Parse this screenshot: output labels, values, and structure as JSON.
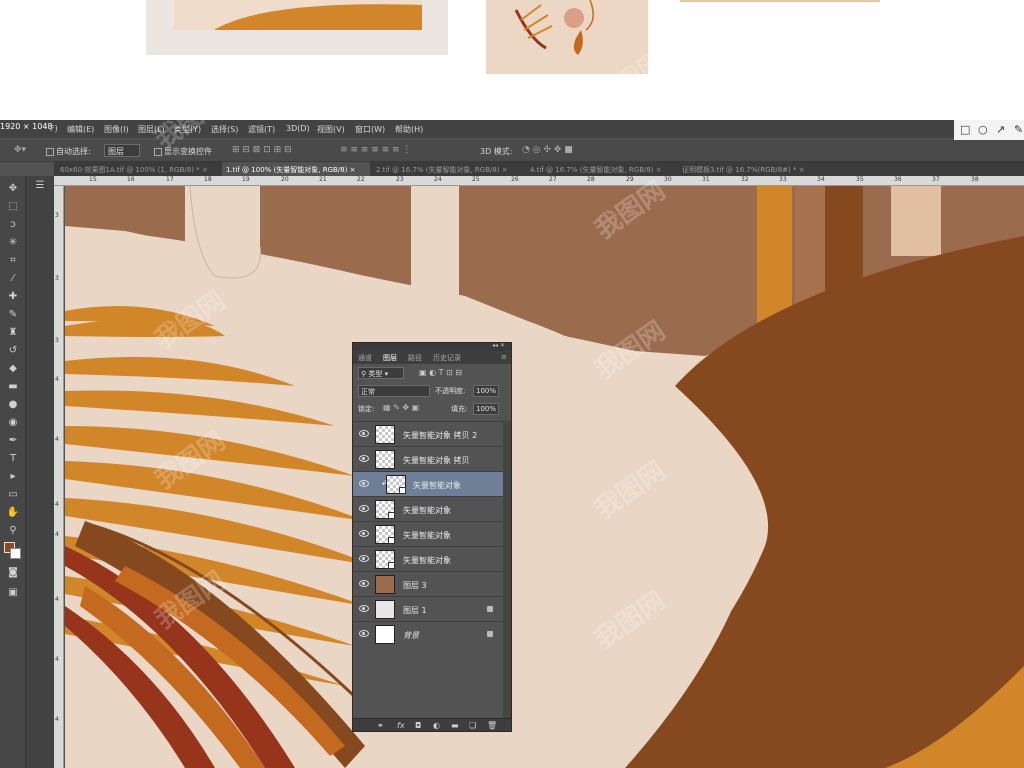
{
  "window": {
    "size_label": "1920 × 1048",
    "menu": [
      "编辑(E)",
      "图像(I)",
      "图层(L)",
      "类型(Y)",
      "选择(S)",
      "滤镜(T)",
      "3D(D)",
      "视图(V)",
      "窗口(W)",
      "帮助(H)"
    ],
    "menu_partial": "F)"
  },
  "options_bar": {
    "auto_select_label": "自动选择:",
    "auto_select_value": "图层",
    "show_transform_label": "显示变换控件",
    "mode_3d_label": "3D 模式:"
  },
  "tabs": [
    {
      "label": "60x60-效果图1A.tif @ 100% (1, RGB/8) *",
      "close": "×",
      "active": false
    },
    {
      "label": "1.tif @ 100% (矢量智能对象, RGB/8)",
      "close": "×",
      "active": true
    },
    {
      "label": "2.tif @ 16.7% (矢量智能对象, RGB/8)",
      "close": "×",
      "active": false
    },
    {
      "label": "4.tif @ 16.7% (矢量智能对象, RGB/8)",
      "close": "×",
      "active": false
    },
    {
      "label": "证明模板3.tif @ 16.7%(RGB/8#) *",
      "close": "×",
      "active": false
    }
  ],
  "ruler": {
    "top": [
      "15",
      "16",
      "17",
      "18",
      "19",
      "20",
      "21",
      "22",
      "23",
      "24",
      "25",
      "26",
      "27",
      "28",
      "29",
      "30",
      "31",
      "32",
      "33",
      "34",
      "35",
      "36",
      "37",
      "38"
    ],
    "left": [
      "3",
      "3",
      "3",
      "4",
      "4",
      "4",
      "4",
      "4",
      "4",
      "4"
    ]
  },
  "layers_panel": {
    "tabs": [
      "通道",
      "图层",
      "路径",
      "历史记录"
    ],
    "filter_label": "类型",
    "blend_mode": "正常",
    "opacity_label": "不透明度:",
    "opacity_value": "100%",
    "lock_label": "锁定:",
    "fill_label": "填充:",
    "fill_value": "100%",
    "layers": [
      {
        "name": "矢量智能对象 拷贝 2",
        "selected": false,
        "locked": false
      },
      {
        "name": "矢量智能对象 拷贝",
        "selected": false,
        "locked": false
      },
      {
        "name": "矢量智能对象",
        "selected": true,
        "locked": false
      },
      {
        "name": "矢量智能对象",
        "selected": false,
        "locked": false
      },
      {
        "name": "矢量智能对象",
        "selected": false,
        "locked": false
      },
      {
        "name": "矢量智能对象",
        "selected": false,
        "locked": false
      },
      {
        "name": "图层 3",
        "selected": false,
        "locked": false
      },
      {
        "name": "图层 1",
        "selected": false,
        "locked": true
      },
      {
        "name": "背景",
        "selected": false,
        "locked": true
      }
    ],
    "bottom_icons": [
      "link-layers-icon",
      "fx-icon",
      "mask-icon",
      "adjustment-icon",
      "group-icon",
      "new-layer-icon",
      "delete-icon"
    ]
  },
  "colors": {
    "foreground": "#8b4a22",
    "background": "#ffffff",
    "canvas_bg": "#ead6c5",
    "orange": "#d1862a",
    "brown": "#8b4a22",
    "rust": "#96341c"
  },
  "watermark": "我图网"
}
